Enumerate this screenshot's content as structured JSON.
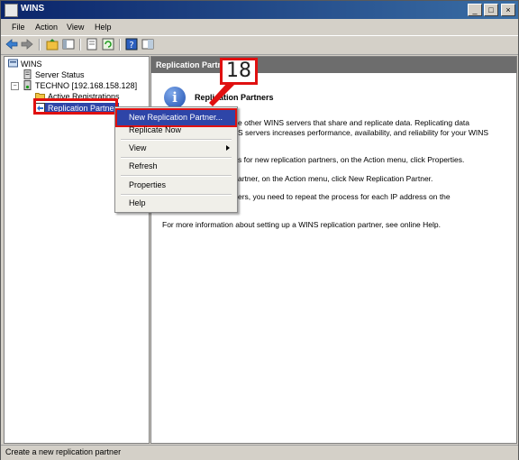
{
  "window": {
    "title": "WINS",
    "min": "_",
    "max": "□",
    "close": "×"
  },
  "menu": [
    "File",
    "Action",
    "View",
    "Help"
  ],
  "tree": {
    "root": "WINS",
    "server_status": "Server Status",
    "server": "TECHNO [192.168.158.128]",
    "active_registrations": "Active Registrations",
    "replication_partners": "Replication Partner"
  },
  "header": {
    "title": "Replication Partn"
  },
  "content": {
    "heading": "Replication Partners",
    "lines": [
      "e other WINS servers that share and replicate data. Replicating data",
      "S servers increases performance, availability, and reliability for your WINS",
      "s for new replication partners, on the Action menu, click Properties.",
      "artner, on the Action menu, click New Replication Partner.",
      "ers, you need to repeat the process for each IP address on the",
      "For more information about setting up a WINS replication partner, see online Help."
    ]
  },
  "context_menu": {
    "new_partner": "New Replication Partner...",
    "replicate_now": "Replicate Now",
    "view": "View",
    "refresh": "Refresh",
    "properties": "Properties",
    "help": "Help"
  },
  "callout": {
    "step": "18"
  },
  "status": {
    "text": "Create a new replication partner"
  },
  "colors": {
    "title_bar": "#0a246a",
    "header_bar": "#6d6d6d",
    "selection": "#2e45a8",
    "highlight": "#e01010"
  }
}
